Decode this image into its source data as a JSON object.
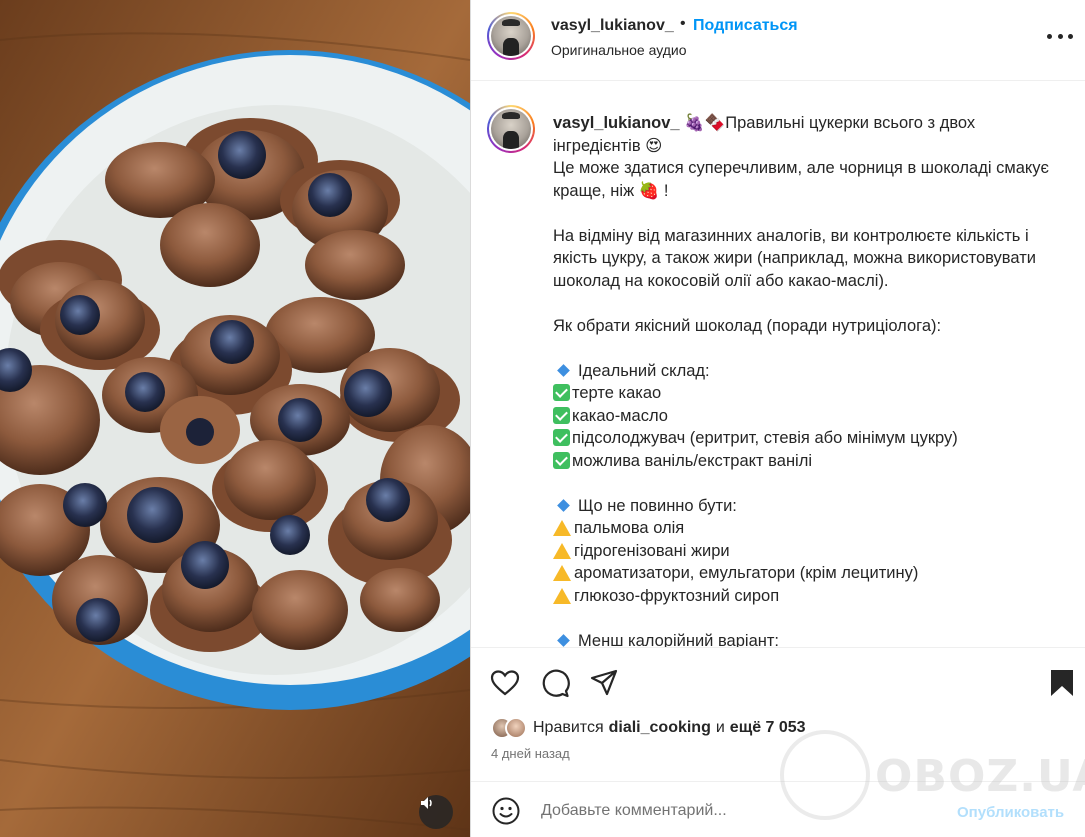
{
  "header": {
    "username": "vasyl_lukianov_",
    "separator": "•",
    "follow_label": "Подписаться",
    "audio_label": "Оригинальное аудио"
  },
  "caption": {
    "username": "vasyl_lukianov_",
    "lines": [
      "🍇🍫Правильні цукерки всього з двох",
      "інгредієнтів 😍",
      "Це може здатися суперечливим, але чорниця в шоколаді смакує",
      "краще, ніж 🍓 !",
      "",
      "На відміну від магазинних аналогів, ви контролюєте кількість і",
      "якість цукру, а також жири (наприклад, можна використовувати",
      "шоколад на кокосовій олії або какао-маслі).",
      "",
      "Як обрати якісний шоколад (поради нутриціолога):",
      "",
      "Ідеальний склад:",
      "терте какао",
      "какао-масло",
      "підсолоджувач (еритрит, стевія або мінімум цукру)",
      "можлива ваніль/екстракт ванілі",
      "",
      "Що не повинно бути:",
      "пальмова олія",
      "гідрогенізовані жири",
      "ароматизатори, емульгатори (крім лецитину)",
      "глюкозо-фруктозний сироп",
      "",
      "Менш калорійний варіант:"
    ],
    "line_markers": [
      "",
      "",
      "",
      "",
      "",
      "",
      "",
      "",
      "",
      "",
      "",
      "diamond",
      "check",
      "check",
      "check",
      "check",
      "",
      "diamond",
      "warning",
      "warning",
      "warning",
      "warning",
      "",
      "diamond"
    ]
  },
  "actions": {
    "like_icon": "heart-icon",
    "comment_icon": "comment-icon",
    "share_icon": "share-icon",
    "save_icon": "bookmark-icon"
  },
  "likes": {
    "prefix": "Нравится",
    "liked_by": "diali_cooking",
    "conjunction": "и",
    "others": "ещё 7 053"
  },
  "timestamp": "4 дней назад",
  "comment": {
    "placeholder": "Добавьте комментарий...",
    "post_label": "Опубликовать",
    "emoji_icon": "emoji-icon"
  },
  "watermark": {
    "text": "OBOZ.UA"
  },
  "media": {
    "audio_icon": "speaker-icon"
  }
}
